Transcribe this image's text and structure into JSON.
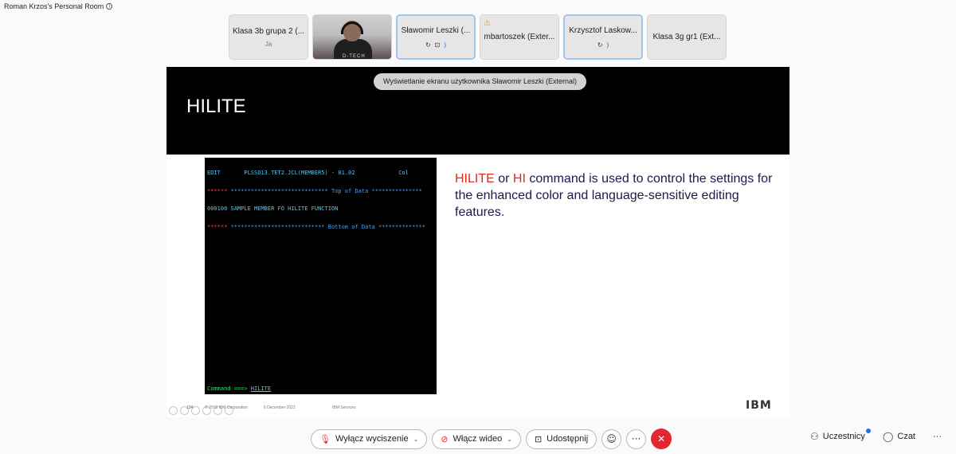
{
  "room": {
    "title": "Roman Krzos's Personal Room",
    "info_icon": "i"
  },
  "participants": [
    {
      "name": "Klasa 3b grupa 2 (...",
      "sub": "Ja",
      "active": false
    },
    {
      "name": "",
      "video": true,
      "shirt_text": "D-TECH"
    },
    {
      "name": "Sławomir Leszki (...",
      "icons": [
        "↻",
        "⊡"
      ],
      "extra": ")",
      "active": true
    },
    {
      "name": "mbartoszek (Exter...",
      "warning": "⚠",
      "active": false
    },
    {
      "name": "Krzysztof Laskow...",
      "icons": [
        "↻"
      ],
      "extra": ")",
      "active": true
    },
    {
      "name": "Klasa 3g gr1 (Ext...",
      "active": false
    }
  ],
  "share": {
    "banner": "Wyświetlanie ekranu użytkownika Sławomir Leszki (External)",
    "slide_title": "HILITE",
    "terminal": {
      "line1": "EDIT       PLSSO13.TET2.JCL(MEMBER5) - 01.02             Col",
      "line2_marker": "******",
      "line2_text": " ***************************** Top of Data ***************",
      "line3": "000100 SAMPLE MEMBER FO HILITE FUNCTION",
      "line4_marker": "******",
      "line4_text": " **************************** Bottom of Data **************",
      "command_prompt": "Command ===> ",
      "command_value": "HILITE"
    },
    "text_red1": "HILITE",
    "text_mid1": " or ",
    "text_red2": "HI",
    "text_rest": " command is used to control the settings for the enhanced color and language-sensitive editing features.",
    "footer_page": "134",
    "footer_copy": "© 2018 IBM Corporation",
    "footer_date": "6 December 2021",
    "footer_service": "IBM Services",
    "logo": "IBM"
  },
  "toolbar": {
    "mute_label": "Wyłącz wyciszenie",
    "video_label": "Włącz wideo",
    "share_label": "Udostępnij",
    "reactions_icon": "☺",
    "more_icon": "···",
    "end_icon": "✕"
  },
  "right": {
    "participants_label": "Uczestnicy",
    "chat_label": "Czat",
    "more_icon": "···"
  }
}
